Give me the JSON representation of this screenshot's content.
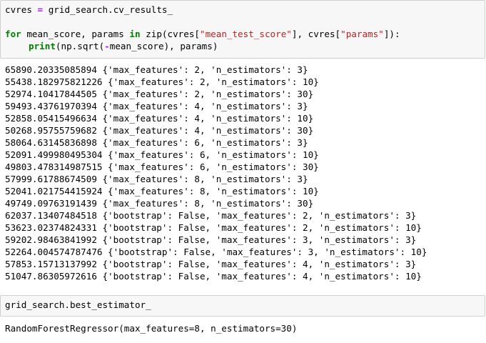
{
  "cell1": {
    "line1": {
      "var": "cvres",
      "eq": "=",
      "rhs": "grid_search.cv_results_"
    },
    "line2": {
      "kw_for": "for",
      "targets": " mean_score, params ",
      "kw_in": "in",
      "call_open": " zip(cvres[",
      "str1": "\"mean_test_score\"",
      "mid": "], cvres[",
      "str2": "\"params\"",
      "close": "]):"
    },
    "line3": {
      "fn": "print",
      "args_open": "(np.sqrt(",
      "minus": "-",
      "args_close": "mean_score), params)"
    }
  },
  "output_lines": [
    "65890.20335085894 {'max_features': 2, 'n_estimators': 3}",
    "55438.182975821226 {'max_features': 2, 'n_estimators': 10}",
    "52974.10417844505 {'max_features': 2, 'n_estimators': 30}",
    "59493.43761970394 {'max_features': 4, 'n_estimators': 3}",
    "52858.05415496634 {'max_features': 4, 'n_estimators': 10}",
    "50268.95755759682 {'max_features': 4, 'n_estimators': 30}",
    "58064.63145836898 {'max_features': 6, 'n_estimators': 3}",
    "52091.499980495304 {'max_features': 6, 'n_estimators': 10}",
    "49803.478314987515 {'max_features': 6, 'n_estimators': 30}",
    "57999.61788674509 {'max_features': 8, 'n_estimators': 3}",
    "52041.021754415924 {'max_features': 8, 'n_estimators': 10}",
    "49749.09763191439 {'max_features': 8, 'n_estimators': 30}",
    "62037.13407484518 {'bootstrap': False, 'max_features': 2, 'n_estimators': 3}",
    "53623.02374824331 {'bootstrap': False, 'max_features': 2, 'n_estimators': 10}",
    "59202.98463841992 {'bootstrap': False, 'max_features': 3, 'n_estimators': 3}",
    "52264.004574787476 {'bootstrap': False, 'max_features': 3, 'n_estimators': 10}",
    "57853.15713137992 {'bootstrap': False, 'max_features': 4, 'n_estimators': 3}",
    "51047.86305972616 {'bootstrap': False, 'max_features': 4, 'n_estimators': 10}"
  ],
  "cell2": {
    "code": "grid_search.best_estimator_"
  },
  "output2": "RandomForestRegressor(max_features=8, n_estimators=30)"
}
